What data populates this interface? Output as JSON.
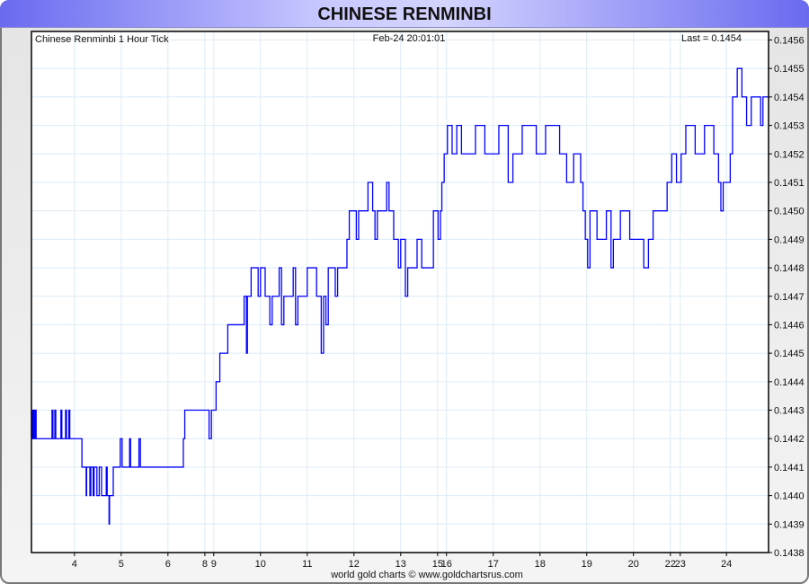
{
  "header": {
    "title": "CHINESE RENMINBI"
  },
  "footer": {
    "credit": "world gold charts © www.goldchartsrus.com"
  },
  "chart_data": {
    "type": "line",
    "title": "Chinese Renminbi 1 Hour Tick",
    "timestamp": "Feb-24  20:01:01",
    "last_label": "Last = 0.1454",
    "line_color": "#0000ff",
    "grid": true,
    "xlim": [
      0,
      15.77
    ],
    "ylim": [
      0.1438,
      0.14563
    ],
    "y_ticks": [
      "0.1456",
      "0.1455",
      "0.1454",
      "0.1453",
      "0.1452",
      "0.1451",
      "0.1450",
      "0.1449",
      "0.1448",
      "0.1447",
      "0.1446",
      "0.1445",
      "0.1444",
      "0.1443",
      "0.1442",
      "0.1441",
      "0.1440",
      "0.1439",
      "0.1438"
    ],
    "x_ticks": [
      {
        "label": "4",
        "x": 0.92
      },
      {
        "label": "5",
        "x": 1.92
      },
      {
        "label": "6",
        "x": 2.92
      },
      {
        "label": "8",
        "x": 3.71
      },
      {
        "label": "9",
        "x": 3.9
      },
      {
        "label": "10",
        "x": 4.9
      },
      {
        "label": "11",
        "x": 5.9
      },
      {
        "label": "12",
        "x": 6.9
      },
      {
        "label": "13",
        "x": 7.9
      },
      {
        "label": "15",
        "x": 8.69
      },
      {
        "label": "16",
        "x": 8.88
      },
      {
        "label": "17",
        "x": 9.88
      },
      {
        "label": "18",
        "x": 10.88
      },
      {
        "label": "19",
        "x": 11.88
      },
      {
        "label": "20",
        "x": 12.88
      },
      {
        "label": "22",
        "x": 13.67
      },
      {
        "label": "23",
        "x": 13.88
      },
      {
        "label": "24",
        "x": 14.87
      }
    ],
    "points": [
      [
        0,
        0.1443
      ],
      [
        0.02,
        0.1442
      ],
      [
        0.04,
        0.1443
      ],
      [
        0.06,
        0.1442
      ],
      [
        0.08,
        0.1443
      ],
      [
        0.1,
        0.1442
      ],
      [
        0.44,
        0.1443
      ],
      [
        0.46,
        0.1442
      ],
      [
        0.5,
        0.1443
      ],
      [
        0.52,
        0.1442
      ],
      [
        0.63,
        0.1443
      ],
      [
        0.65,
        0.1442
      ],
      [
        0.73,
        0.1443
      ],
      [
        0.75,
        0.1442
      ],
      [
        0.8,
        0.1443
      ],
      [
        0.82,
        0.1442
      ],
      [
        1.08,
        0.1441
      ],
      [
        1.17,
        0.144
      ],
      [
        1.18,
        0.1441
      ],
      [
        1.25,
        0.144
      ],
      [
        1.27,
        0.1441
      ],
      [
        1.32,
        0.144
      ],
      [
        1.34,
        0.1441
      ],
      [
        1.4,
        0.144
      ],
      [
        1.45,
        0.1441
      ],
      [
        1.5,
        0.144
      ],
      [
        1.6,
        0.1441
      ],
      [
        1.62,
        0.144
      ],
      [
        1.66,
        0.1439
      ],
      [
        1.67,
        0.144
      ],
      [
        1.75,
        0.1441
      ],
      [
        1.9,
        0.1442
      ],
      [
        1.94,
        0.1441
      ],
      [
        2.1,
        0.1442
      ],
      [
        2.12,
        0.1441
      ],
      [
        2.3,
        0.1442
      ],
      [
        2.33,
        0.1441
      ],
      [
        3.25,
        0.1442
      ],
      [
        3.28,
        0.1443
      ],
      [
        3.8,
        0.1442
      ],
      [
        3.85,
        0.1443
      ],
      [
        3.95,
        0.1444
      ],
      [
        4.03,
        0.1445
      ],
      [
        4.2,
        0.1446
      ],
      [
        4.55,
        0.1447
      ],
      [
        4.6,
        0.1445
      ],
      [
        4.62,
        0.1447
      ],
      [
        4.7,
        0.1448
      ],
      [
        4.85,
        0.1447
      ],
      [
        4.9,
        0.1448
      ],
      [
        5.0,
        0.1447
      ],
      [
        5.1,
        0.1446
      ],
      [
        5.15,
        0.1447
      ],
      [
        5.3,
        0.1448
      ],
      [
        5.35,
        0.1446
      ],
      [
        5.4,
        0.1447
      ],
      [
        5.6,
        0.1448
      ],
      [
        5.65,
        0.1446
      ],
      [
        5.7,
        0.1447
      ],
      [
        5.9,
        0.1448
      ],
      [
        6.1,
        0.1447
      ],
      [
        6.2,
        0.1445
      ],
      [
        6.25,
        0.1447
      ],
      [
        6.3,
        0.1446
      ],
      [
        6.35,
        0.1448
      ],
      [
        6.5,
        0.1447
      ],
      [
        6.55,
        0.1448
      ],
      [
        6.75,
        0.1449
      ],
      [
        6.8,
        0.145
      ],
      [
        6.95,
        0.1449
      ],
      [
        7.0,
        0.145
      ],
      [
        7.2,
        0.1451
      ],
      [
        7.3,
        0.145
      ],
      [
        7.35,
        0.1449
      ],
      [
        7.4,
        0.145
      ],
      [
        7.6,
        0.1451
      ],
      [
        7.65,
        0.145
      ],
      [
        7.75,
        0.1449
      ],
      [
        7.85,
        0.1448
      ],
      [
        7.9,
        0.1449
      ],
      [
        8.0,
        0.1447
      ],
      [
        8.05,
        0.1448
      ],
      [
        8.25,
        0.1449
      ],
      [
        8.35,
        0.1448
      ],
      [
        8.6,
        0.145
      ],
      [
        8.7,
        0.1449
      ],
      [
        8.75,
        0.145
      ],
      [
        8.78,
        0.1451
      ],
      [
        8.83,
        0.1452
      ],
      [
        8.9,
        0.1453
      ],
      [
        9.0,
        0.1452
      ],
      [
        9.1,
        0.1453
      ],
      [
        9.2,
        0.1452
      ],
      [
        9.5,
        0.1453
      ],
      [
        9.7,
        0.1452
      ],
      [
        10.0,
        0.1453
      ],
      [
        10.2,
        0.1451
      ],
      [
        10.3,
        0.1452
      ],
      [
        10.5,
        0.1453
      ],
      [
        10.8,
        0.1452
      ],
      [
        11.0,
        0.1453
      ],
      [
        11.3,
        0.1452
      ],
      [
        11.45,
        0.1451
      ],
      [
        11.6,
        0.1452
      ],
      [
        11.75,
        0.1451
      ],
      [
        11.8,
        0.145
      ],
      [
        11.85,
        0.1449
      ],
      [
        11.9,
        0.1448
      ],
      [
        11.95,
        0.145
      ],
      [
        12.1,
        0.1449
      ],
      [
        12.3,
        0.145
      ],
      [
        12.4,
        0.1448
      ],
      [
        12.45,
        0.1449
      ],
      [
        12.6,
        0.145
      ],
      [
        12.8,
        0.1449
      ],
      [
        13.1,
        0.1448
      ],
      [
        13.2,
        0.1449
      ],
      [
        13.3,
        0.145
      ],
      [
        13.6,
        0.1451
      ],
      [
        13.7,
        0.1452
      ],
      [
        13.8,
        0.1451
      ],
      [
        13.9,
        0.1452
      ],
      [
        14.0,
        0.1453
      ],
      [
        14.2,
        0.1452
      ],
      [
        14.4,
        0.1453
      ],
      [
        14.6,
        0.1452
      ],
      [
        14.7,
        0.1451
      ],
      [
        14.75,
        0.145
      ],
      [
        14.8,
        0.1451
      ],
      [
        14.95,
        0.1452
      ],
      [
        15.0,
        0.1454
      ],
      [
        15.1,
        0.1455
      ],
      [
        15.2,
        0.1454
      ],
      [
        15.3,
        0.1453
      ],
      [
        15.4,
        0.1454
      ],
      [
        15.6,
        0.1453
      ],
      [
        15.65,
        0.1454
      ],
      [
        15.77,
        0.1454
      ]
    ]
  }
}
